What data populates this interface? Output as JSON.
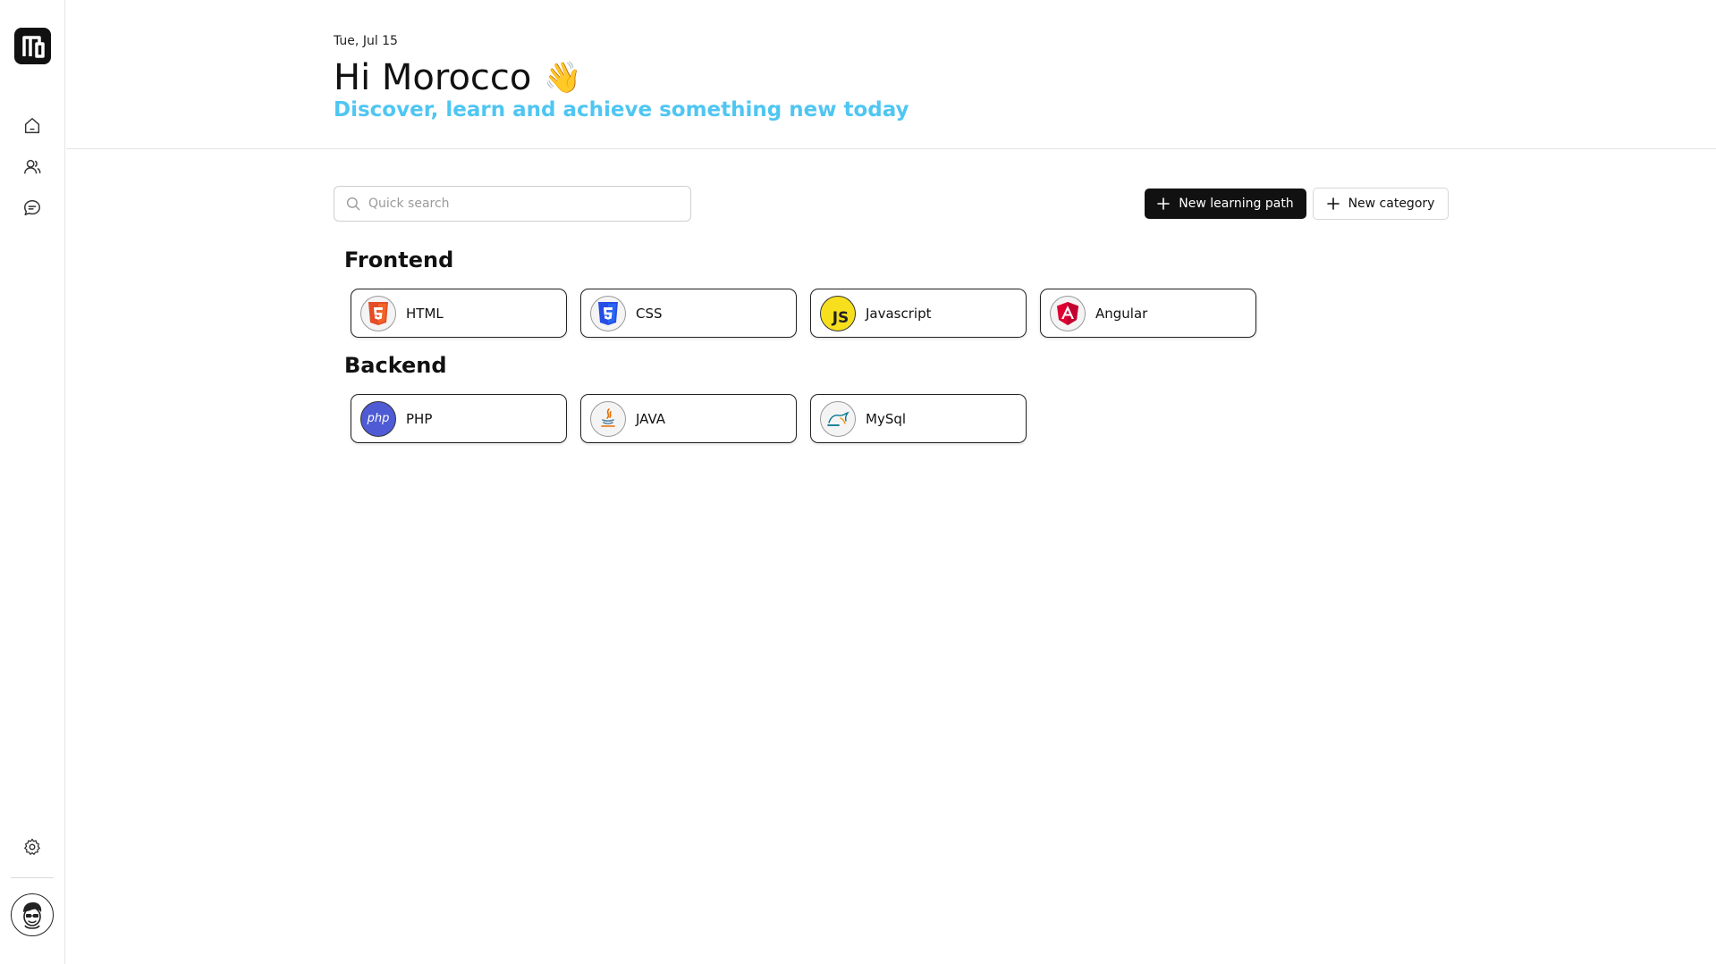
{
  "sidebar": {
    "logo": "M",
    "items": [
      {
        "name": "home",
        "icon": "home-icon"
      },
      {
        "name": "users",
        "icon": "users-icon"
      },
      {
        "name": "messages",
        "icon": "chat-icon"
      }
    ],
    "settings_icon": "gear-icon",
    "avatar_icon": "avatar-icon"
  },
  "header": {
    "date": "Tue, Jul 15",
    "greeting": "Hi Morocco",
    "wave": "👋",
    "tagline": "Discover, learn and achieve something new today"
  },
  "toolbar": {
    "search_placeholder": "Quick search",
    "new_path_label": "New learning path",
    "new_category_label": "New category"
  },
  "sections": [
    {
      "title": "Frontend",
      "items": [
        {
          "label": "HTML",
          "icon": "html5-icon"
        },
        {
          "label": "CSS",
          "icon": "css3-icon"
        },
        {
          "label": "Javascript",
          "icon": "javascript-icon",
          "icon_text": "JS"
        },
        {
          "label": "Angular",
          "icon": "angular-icon"
        }
      ]
    },
    {
      "title": "Backend",
      "items": [
        {
          "label": "PHP",
          "icon": "php-icon",
          "icon_text": "php"
        },
        {
          "label": "JAVA",
          "icon": "java-icon"
        },
        {
          "label": "MySql",
          "icon": "mysql-icon"
        }
      ]
    }
  ],
  "colors": {
    "accent": "#4fc6f2",
    "primary_button": "#111111",
    "html": "#e44d26",
    "css": "#264de4",
    "javascript": "#f7df1e",
    "angular": "#dd0031",
    "php": "#4f5b93"
  }
}
